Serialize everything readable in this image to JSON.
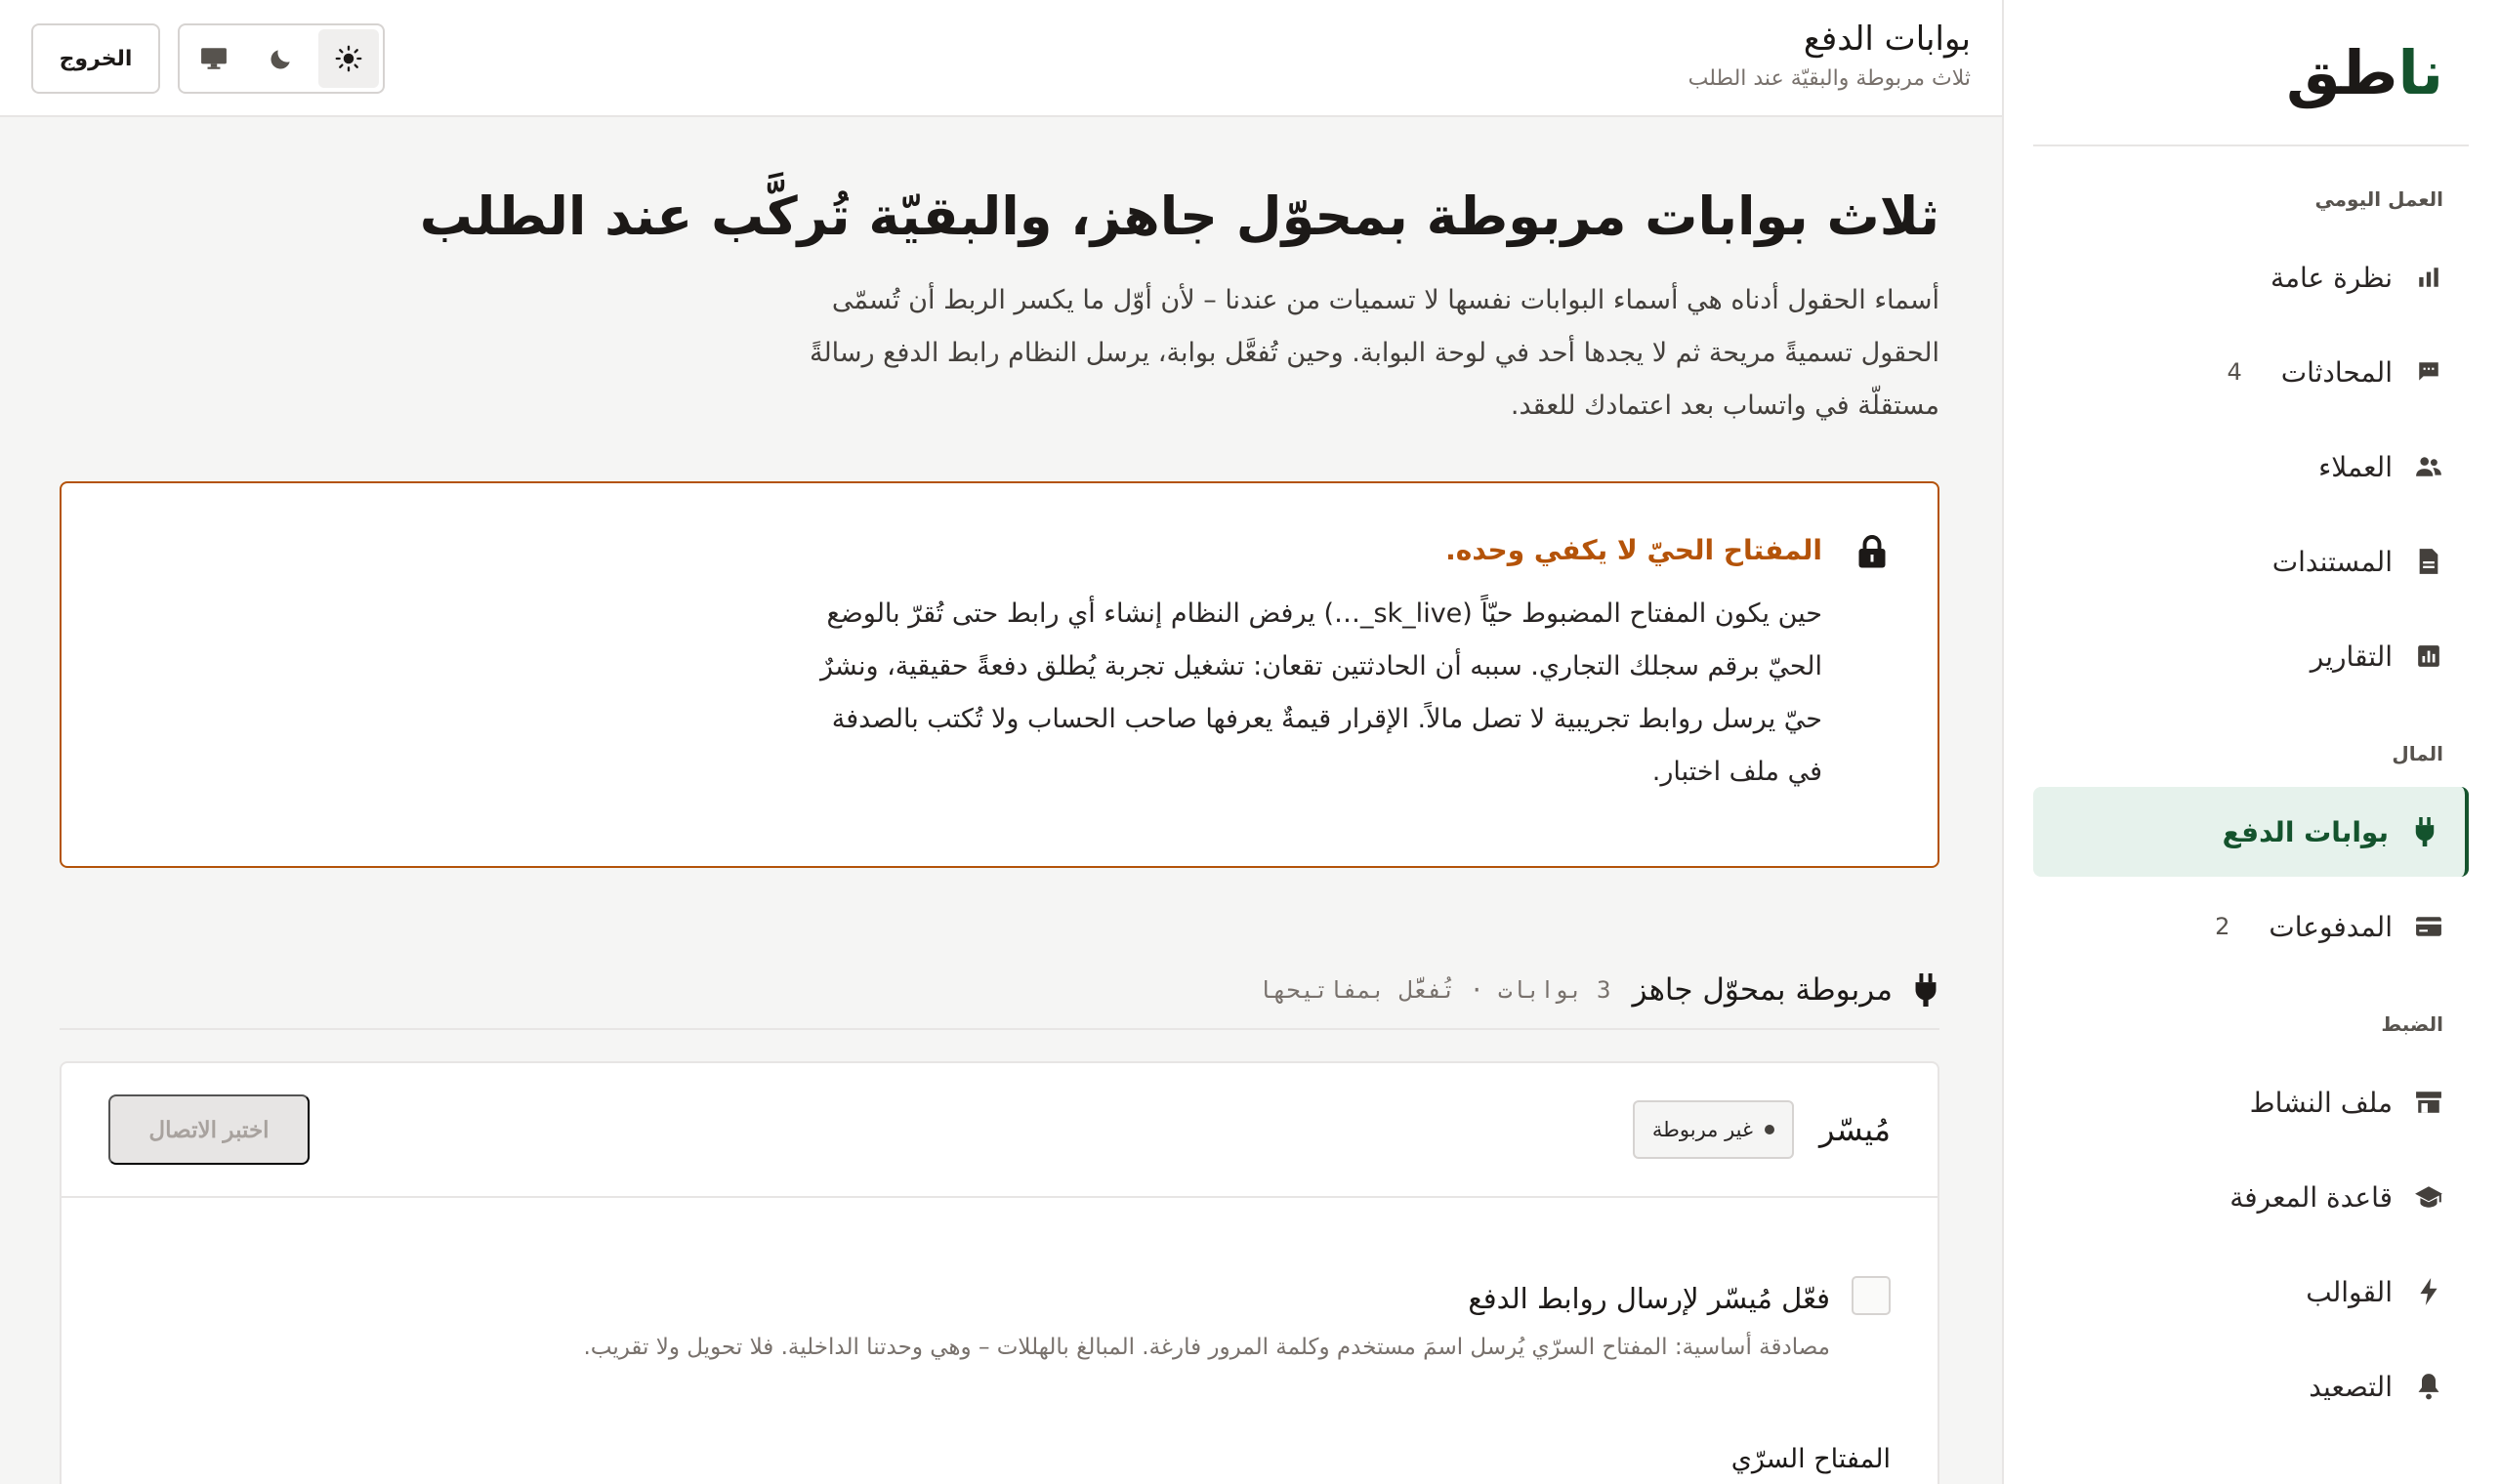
{
  "sidebar": {
    "brand_accent": "نا",
    "brand_rest": "طق",
    "sections": [
      {
        "heading": "العمل اليومي",
        "items": [
          {
            "label": "نظرة عامة",
            "icon": "bar-chart-icon",
            "count": ""
          },
          {
            "label": "المحادثات",
            "icon": "chat-icon",
            "count": "4"
          },
          {
            "label": "العملاء",
            "icon": "users-icon",
            "count": ""
          },
          {
            "label": "المستندات",
            "icon": "document-icon",
            "count": ""
          },
          {
            "label": "التقارير",
            "icon": "report-icon",
            "count": ""
          }
        ]
      },
      {
        "heading": "المال",
        "items": [
          {
            "label": "بوابات الدفع",
            "icon": "plug-icon",
            "count": "",
            "active": true
          },
          {
            "label": "المدفوعات",
            "icon": "credit-card-icon",
            "count": "2"
          }
        ]
      },
      {
        "heading": "الضبط",
        "items": [
          {
            "label": "ملف النشاط",
            "icon": "store-icon",
            "count": ""
          },
          {
            "label": "قاعدة المعرفة",
            "icon": "graduation-cap-icon",
            "count": ""
          },
          {
            "label": "القوالب",
            "icon": "bolt-icon",
            "count": ""
          },
          {
            "label": "التصعيد",
            "icon": "bell-icon",
            "count": ""
          }
        ]
      }
    ]
  },
  "topbar": {
    "title": "بوابات الدفع",
    "subtitle": "ثلاث مربوطة والبقيّة عند الطلب",
    "logout_label": "الخروج",
    "theme_options": [
      "light-mode-icon",
      "dark-mode-icon",
      "system-mode-icon"
    ],
    "theme_selected": "light-mode-icon"
  },
  "main": {
    "title": "ثلاث بوابات مربوطة بمحوّل جاهز، والبقيّة تُركَّب عند الطلب",
    "description": "أسماء الحقول أدناه هي أسماء البوابات نفسها لا تسميات من عندنا – لأن أوّل ما يكسر الربط أن تُسمّى الحقول تسميةً مريحة ثم لا يجدها أحد في لوحة البوابة. وحين تُفعَّل بوابة، يرسل النظام رابط الدفع رسالةً مستقلّة في واتساب بعد اعتمادك للعقد.",
    "alert": {
      "title": "المفتاح الحيّ لا يكفي وحده.",
      "body": "حين يكون المفتاح المضبوط حيّاً (sk_live_…) يرفض النظام إنشاء أي رابط حتى تُقرّ بالوضع الحيّ برقم سجلك التجاري. سببه أن الحادثتين تقعان: تشغيل تجربة يُطلق دفعةً حقيقية، ونشرٌ حيّ يرسل روابط تجريبية لا تصل مالاً. الإقرار قيمةٌ يعرفها صاحب الحساب ولا تُكتب بالصدفة في ملف اختبار."
    },
    "section": {
      "title": "مربوطة بمحوّل جاهز",
      "meta": "3 بوابات · تُفعَّل بمفاتيحها"
    },
    "gateway": {
      "name": "مُيسّر",
      "status": "غير مربوطة",
      "test_button": "اختبر الاتصال",
      "enable_label": "فعّل مُيسّر لإرسال روابط الدفع",
      "enable_hint": "مصادقة أساسية: المفتاح السرّي يُرسل اسمَ مستخدم وكلمة المرور فارغة. المبالغ بالهللات – وهي وحدتنا الداخلية. فلا تحويل ولا تقريب.",
      "secret_label": "المفتاح السرّي"
    }
  },
  "colors": {
    "brand": "#14532d",
    "warning": "#b45309",
    "active_bg": "#e6f2ec"
  }
}
